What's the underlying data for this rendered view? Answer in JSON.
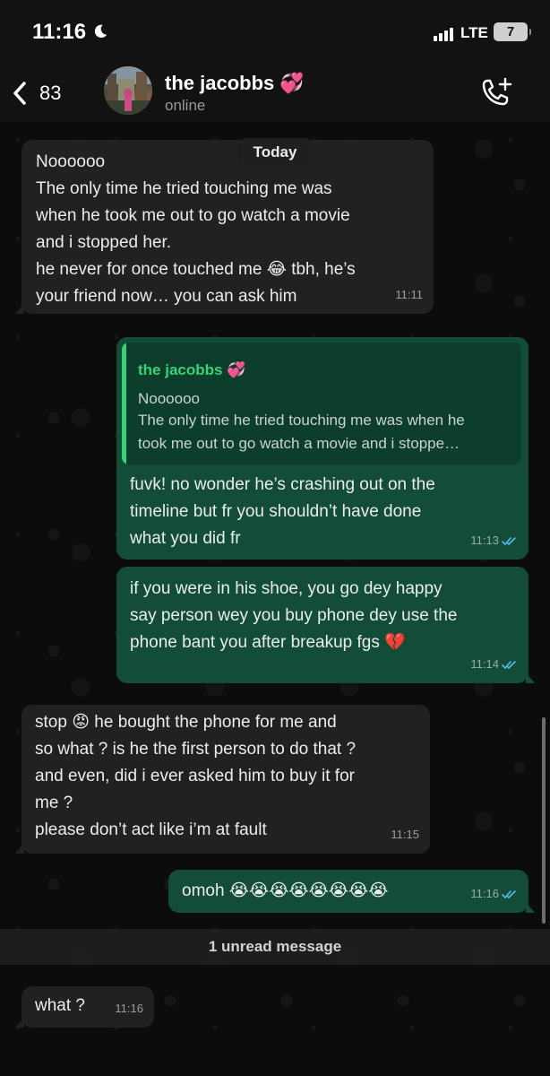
{
  "status_bar": {
    "time": "11:16",
    "network": "LTE",
    "battery": "7"
  },
  "header": {
    "back_count": "83",
    "contact_name": "the jacobbs 💞",
    "contact_status": "online"
  },
  "date_pill": "Today",
  "messages": [
    {
      "direction": "in",
      "text": "Noooooo\nThe only time he tried touching me was\nwhen he took me out to go watch a movie\nand i stopped her.\nhe never for once touched me 😂 tbh, he’s\nyour friend now… you can ask him",
      "time": "11:11"
    },
    {
      "direction": "out",
      "quote": {
        "name": "the jacobbs 💞",
        "line1": "Noooooo",
        "line2": "The only time he tried touching me was when he\ntook me out to go watch a movie and i stoppe…"
      },
      "text": "fuvk! no wonder he’s crashing out on the\ntimeline but fr you shouldn’t have done\nwhat you did fr",
      "time": "11:13",
      "status": "read"
    },
    {
      "direction": "out",
      "text": "if you were in his shoe, you go dey happy\nsay person wey you buy phone dey use the\nphone bant you after breakup fgs 💔",
      "time": "11:14",
      "status": "read"
    },
    {
      "direction": "in",
      "text": "stop 😡 he bought the phone for me and\nso what ? is he the first person to do that ?\nand even, did i ever asked him to buy it for\nme ?\nplease don’t act like i’m at fault",
      "time": "11:15"
    },
    {
      "direction": "out",
      "text": "omoh 😭😭😭😭😭😭😭😭",
      "time": "11:16",
      "status": "read"
    },
    {
      "direction": "in",
      "text": "what ?",
      "time": "11:16"
    }
  ],
  "unread_banner": "1 unread message",
  "colors": {
    "incoming_bubble": "#212121",
    "outgoing_bubble": "#134d37",
    "quote_accent": "#3bd17a",
    "read_ticks": "#53bdeb"
  }
}
